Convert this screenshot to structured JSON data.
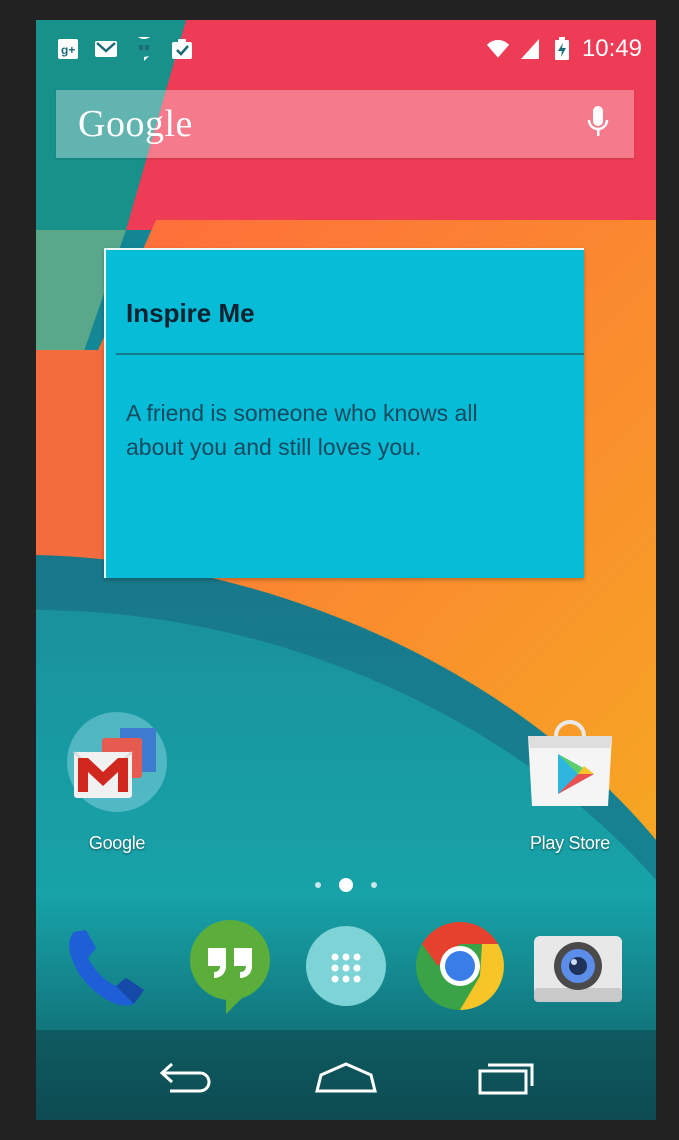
{
  "status_bar": {
    "notification_icons": [
      "google-plus-icon",
      "gmail-icon",
      "hangouts-icon",
      "tasks-icon"
    ],
    "system_icons": [
      "wifi-icon",
      "cell-signal-icon",
      "battery-charging-icon"
    ],
    "time": "10:49"
  },
  "search": {
    "logo_text": "Google",
    "mic_icon": "microphone-icon"
  },
  "widget": {
    "title": "Inspire Me",
    "quote": "A friend is someone who knows all about you and still loves you."
  },
  "home_apps": [
    {
      "label": "Google",
      "icon": "google-folder-icon"
    },
    {
      "label": "Play Store",
      "icon": "play-store-icon"
    }
  ],
  "page_indicator": {
    "pages": 3,
    "current": 2
  },
  "dock": [
    {
      "name": "phone",
      "icon": "phone-icon"
    },
    {
      "name": "hangouts",
      "icon": "hangouts-icon"
    },
    {
      "name": "app-drawer",
      "icon": "app-drawer-icon"
    },
    {
      "name": "chrome",
      "icon": "chrome-icon"
    },
    {
      "name": "camera",
      "icon": "camera-icon"
    }
  ],
  "nav": [
    "back-icon",
    "home-icon",
    "recents-icon"
  ],
  "colors": {
    "widget_bg": "#06bcd6",
    "widget_title": "#0b2230",
    "widget_text": "#134a60"
  }
}
